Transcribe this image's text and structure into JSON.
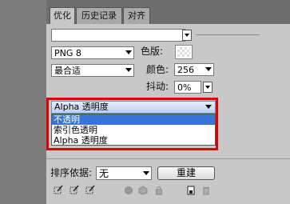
{
  "tabs": [
    {
      "label": "优化",
      "active": true
    },
    {
      "label": "历史记录",
      "active": false
    },
    {
      "label": "对齐",
      "active": false
    }
  ],
  "settings": {
    "preset_value": "",
    "format_value": "PNG 8",
    "reduction_value": "最合适",
    "palette_label": "色版:",
    "colors_label": "颜色:",
    "colors_value": "256",
    "dither_label": "抖动:",
    "dither_value": "0%"
  },
  "transparency": {
    "selected": "Alpha 透明度",
    "options": [
      "不透明",
      "索引色透明",
      "Alpha 透明度"
    ],
    "highlighted_index": 0
  },
  "footer": {
    "sort_label": "排序依据:",
    "sort_value": "无",
    "rebuild_label": "重建"
  },
  "colors": {
    "highlight": "#3875d7",
    "frame": "#e00000"
  }
}
